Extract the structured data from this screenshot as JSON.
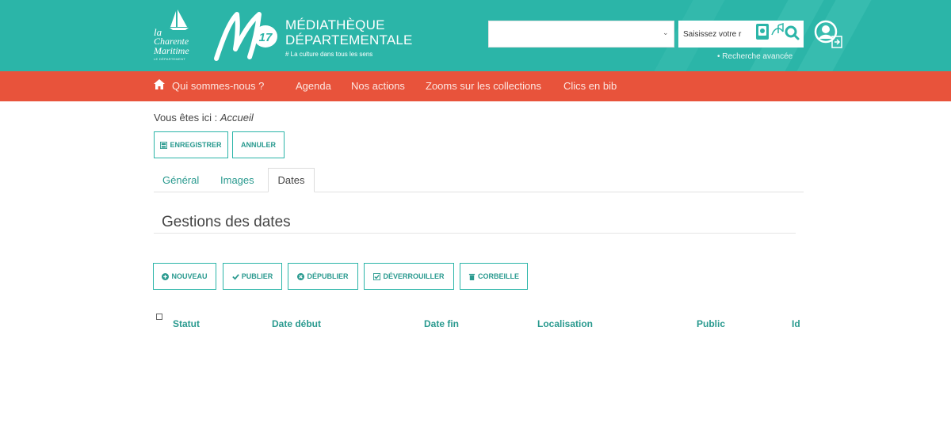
{
  "header": {
    "logo_cm": {
      "la": "la",
      "charente": "Charente",
      "maritime": "Maritime",
      "departement": "LE DÉPARTEMENT"
    },
    "title_line1": "MÉDIATHÈQUE",
    "title_line2": "DÉPARTEMENTALE",
    "subtitle": "# La culture dans tous les sens",
    "search_placeholder": "Saisissez votre r",
    "advanced_search": "• Recherche avancée",
    "colors": {
      "teal": "#2bb5a8",
      "coral": "#e8533b"
    }
  },
  "nav": {
    "home_icon": "home-icon",
    "items": [
      "Qui sommes-nous ?",
      "Agenda",
      "Nos actions",
      "Zooms sur les collections",
      "Clics en bib"
    ]
  },
  "breadcrumb": {
    "prefix": "Vous êtes ici :",
    "current": "Accueil"
  },
  "toolbar": {
    "save": "ENREGISTRER",
    "cancel": "ANNULER"
  },
  "tabs": [
    "Général",
    "Images",
    "Dates"
  ],
  "active_tab": "Dates",
  "section_title": "Gestions des dates",
  "actions": {
    "new": "NOUVEAU",
    "publish": "PUBLIER",
    "unpublish": "DÉPUBLIER",
    "unlock": "DÉVERROUILLER",
    "trash": "CORBEILLE"
  },
  "table": {
    "columns": [
      "Statut",
      "Date début",
      "Date fin",
      "Localisation",
      "Public",
      "Id"
    ]
  }
}
